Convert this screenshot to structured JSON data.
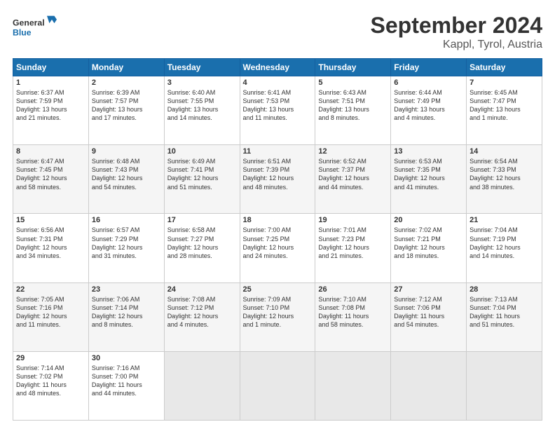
{
  "logo": {
    "text_general": "General",
    "text_blue": "Blue"
  },
  "header": {
    "title": "September 2024",
    "subtitle": "Kappl, Tyrol, Austria"
  },
  "weekdays": [
    "Sunday",
    "Monday",
    "Tuesday",
    "Wednesday",
    "Thursday",
    "Friday",
    "Saturday"
  ],
  "weeks": [
    [
      {
        "day": "1",
        "info": "Sunrise: 6:37 AM\nSunset: 7:59 PM\nDaylight: 13 hours\nand 21 minutes."
      },
      {
        "day": "2",
        "info": "Sunrise: 6:39 AM\nSunset: 7:57 PM\nDaylight: 13 hours\nand 17 minutes."
      },
      {
        "day": "3",
        "info": "Sunrise: 6:40 AM\nSunset: 7:55 PM\nDaylight: 13 hours\nand 14 minutes."
      },
      {
        "day": "4",
        "info": "Sunrise: 6:41 AM\nSunset: 7:53 PM\nDaylight: 13 hours\nand 11 minutes."
      },
      {
        "day": "5",
        "info": "Sunrise: 6:43 AM\nSunset: 7:51 PM\nDaylight: 13 hours\nand 8 minutes."
      },
      {
        "day": "6",
        "info": "Sunrise: 6:44 AM\nSunset: 7:49 PM\nDaylight: 13 hours\nand 4 minutes."
      },
      {
        "day": "7",
        "info": "Sunrise: 6:45 AM\nSunset: 7:47 PM\nDaylight: 13 hours\nand 1 minute."
      }
    ],
    [
      {
        "day": "8",
        "info": "Sunrise: 6:47 AM\nSunset: 7:45 PM\nDaylight: 12 hours\nand 58 minutes."
      },
      {
        "day": "9",
        "info": "Sunrise: 6:48 AM\nSunset: 7:43 PM\nDaylight: 12 hours\nand 54 minutes."
      },
      {
        "day": "10",
        "info": "Sunrise: 6:49 AM\nSunset: 7:41 PM\nDaylight: 12 hours\nand 51 minutes."
      },
      {
        "day": "11",
        "info": "Sunrise: 6:51 AM\nSunset: 7:39 PM\nDaylight: 12 hours\nand 48 minutes."
      },
      {
        "day": "12",
        "info": "Sunrise: 6:52 AM\nSunset: 7:37 PM\nDaylight: 12 hours\nand 44 minutes."
      },
      {
        "day": "13",
        "info": "Sunrise: 6:53 AM\nSunset: 7:35 PM\nDaylight: 12 hours\nand 41 minutes."
      },
      {
        "day": "14",
        "info": "Sunrise: 6:54 AM\nSunset: 7:33 PM\nDaylight: 12 hours\nand 38 minutes."
      }
    ],
    [
      {
        "day": "15",
        "info": "Sunrise: 6:56 AM\nSunset: 7:31 PM\nDaylight: 12 hours\nand 34 minutes."
      },
      {
        "day": "16",
        "info": "Sunrise: 6:57 AM\nSunset: 7:29 PM\nDaylight: 12 hours\nand 31 minutes."
      },
      {
        "day": "17",
        "info": "Sunrise: 6:58 AM\nSunset: 7:27 PM\nDaylight: 12 hours\nand 28 minutes."
      },
      {
        "day": "18",
        "info": "Sunrise: 7:00 AM\nSunset: 7:25 PM\nDaylight: 12 hours\nand 24 minutes."
      },
      {
        "day": "19",
        "info": "Sunrise: 7:01 AM\nSunset: 7:23 PM\nDaylight: 12 hours\nand 21 minutes."
      },
      {
        "day": "20",
        "info": "Sunrise: 7:02 AM\nSunset: 7:21 PM\nDaylight: 12 hours\nand 18 minutes."
      },
      {
        "day": "21",
        "info": "Sunrise: 7:04 AM\nSunset: 7:19 PM\nDaylight: 12 hours\nand 14 minutes."
      }
    ],
    [
      {
        "day": "22",
        "info": "Sunrise: 7:05 AM\nSunset: 7:16 PM\nDaylight: 12 hours\nand 11 minutes."
      },
      {
        "day": "23",
        "info": "Sunrise: 7:06 AM\nSunset: 7:14 PM\nDaylight: 12 hours\nand 8 minutes."
      },
      {
        "day": "24",
        "info": "Sunrise: 7:08 AM\nSunset: 7:12 PM\nDaylight: 12 hours\nand 4 minutes."
      },
      {
        "day": "25",
        "info": "Sunrise: 7:09 AM\nSunset: 7:10 PM\nDaylight: 12 hours\nand 1 minute."
      },
      {
        "day": "26",
        "info": "Sunrise: 7:10 AM\nSunset: 7:08 PM\nDaylight: 11 hours\nand 58 minutes."
      },
      {
        "day": "27",
        "info": "Sunrise: 7:12 AM\nSunset: 7:06 PM\nDaylight: 11 hours\nand 54 minutes."
      },
      {
        "day": "28",
        "info": "Sunrise: 7:13 AM\nSunset: 7:04 PM\nDaylight: 11 hours\nand 51 minutes."
      }
    ],
    [
      {
        "day": "29",
        "info": "Sunrise: 7:14 AM\nSunset: 7:02 PM\nDaylight: 11 hours\nand 48 minutes."
      },
      {
        "day": "30",
        "info": "Sunrise: 7:16 AM\nSunset: 7:00 PM\nDaylight: 11 hours\nand 44 minutes."
      },
      {
        "day": "",
        "info": ""
      },
      {
        "day": "",
        "info": ""
      },
      {
        "day": "",
        "info": ""
      },
      {
        "day": "",
        "info": ""
      },
      {
        "day": "",
        "info": ""
      }
    ]
  ]
}
